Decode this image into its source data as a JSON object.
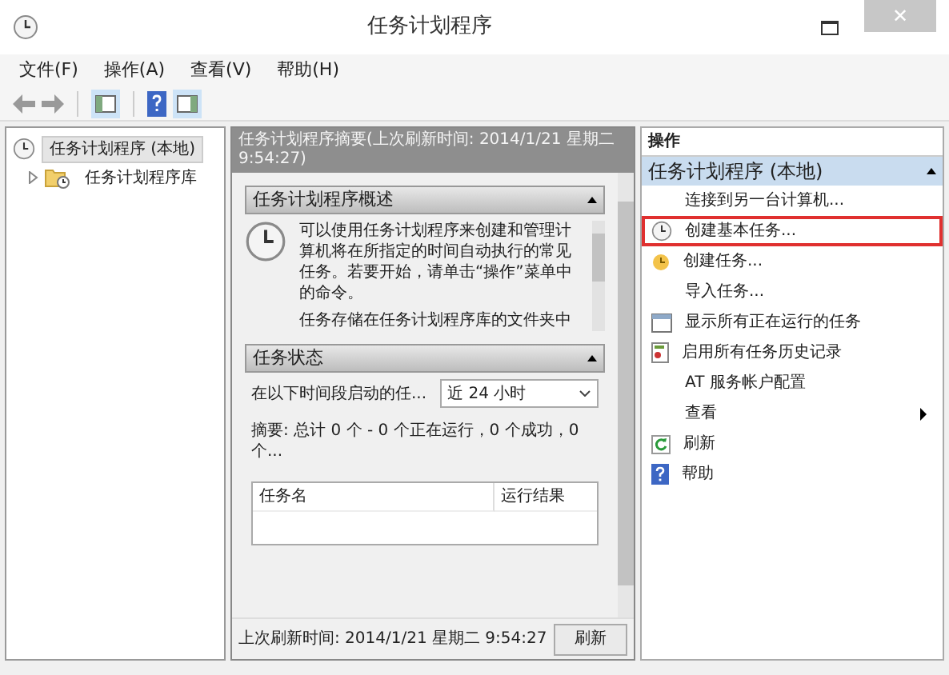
{
  "window": {
    "title": "任务计划程序",
    "close": "✕"
  },
  "menu": [
    "文件(F)",
    "操作(A)",
    "查看(V)",
    "帮助(H)"
  ],
  "tree": [
    {
      "label": "任务计划程序 (本地)",
      "selected": true,
      "children": [
        {
          "label": "任务计划程序库",
          "selected": false,
          "expanded": false
        }
      ]
    }
  ],
  "center": {
    "header": "任务计划程序摘要(上次刷新时间: 2014/1/21 星期二 9:54:27)",
    "overview": {
      "title": "任务计划程序概述",
      "expanded": true,
      "text": "可以使用任务计划程序来创建和管理计算机将在所指定的时间自动执行的常见任务。若要开始，请单击“操作”菜单中的命令。",
      "text_2": "任务存储在任务计划程序库的文件夹中"
    },
    "status": {
      "title": "任务状态",
      "expanded": true,
      "filter_label": "在以下时间段启动的任...",
      "filter_value": "近 24 小时",
      "summary": "摘要: 总计 0 个 - 0 个正在运行，0 个成功，0 个...",
      "columns": [
        "任务名",
        "运行结果"
      ]
    },
    "footer": {
      "text": "上次刷新时间: 2014/1/21 星期二 9:54:27",
      "button": "刷新"
    }
  },
  "actions": {
    "title": "操作",
    "group": "任务计划程序 (本地)",
    "expanded": true,
    "items": [
      {
        "kind": "none",
        "label": "连接到另一台计算机...",
        "highlighted": false,
        "submenu": false
      },
      {
        "kind": "clock",
        "label": "创建基本任务...",
        "highlighted": true,
        "submenu": false
      },
      {
        "kind": "task",
        "label": "创建任务...",
        "highlighted": false,
        "submenu": false
      },
      {
        "kind": "none",
        "label": "导入任务...",
        "highlighted": false,
        "submenu": false
      },
      {
        "kind": "list",
        "label": "显示所有正在运行的任务",
        "highlighted": false,
        "submenu": false
      },
      {
        "kind": "history",
        "label": "启用所有任务历史记录",
        "highlighted": false,
        "submenu": false
      },
      {
        "kind": "none",
        "label": "AT 服务帐户配置",
        "highlighted": false,
        "submenu": false
      },
      {
        "kind": "none",
        "label": "查看",
        "highlighted": false,
        "submenu": true
      },
      {
        "kind": "refresh",
        "label": "刷新",
        "highlighted": false,
        "submenu": false
      },
      {
        "kind": "help",
        "label": "帮助",
        "highlighted": false,
        "submenu": false
      }
    ]
  }
}
